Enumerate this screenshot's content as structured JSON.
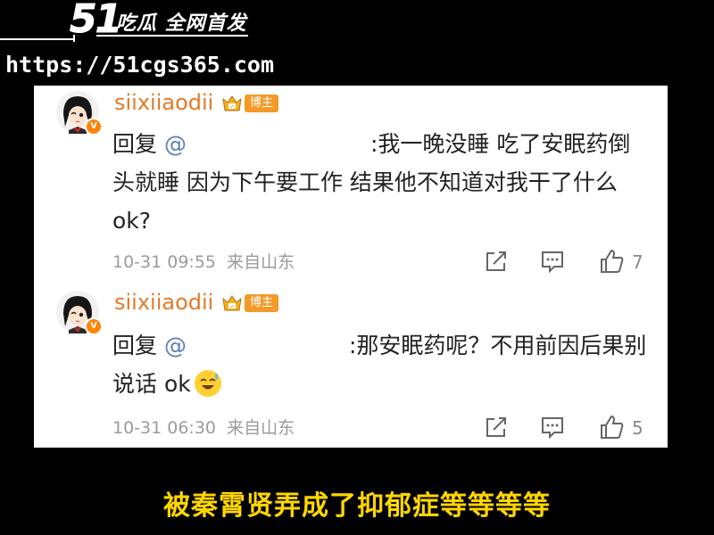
{
  "watermark": {
    "logo": "51",
    "brand": "吃瓜 全网首发",
    "url": "https://51cgs365.com"
  },
  "comments": [
    {
      "username": "siixiiaodii",
      "badge": "博主",
      "reply_prefix": "回复",
      "mention": "@",
      "text": ":我一晚没睡 吃了安眠药倒头就睡 因为下午要工作 结果他不知道对我干了什么 ok?",
      "timestamp": "10-31 09:55",
      "location": "来自山东",
      "likes": "7"
    },
    {
      "username": "siixiiaodii",
      "badge": "博主",
      "reply_prefix": "回复",
      "mention": "@",
      "text": ":那安眠药呢？不用前因后果别说话 ok",
      "timestamp": "10-31 06:30",
      "location": "来自山东",
      "likes": "5"
    }
  ],
  "icons": {
    "verified": "verified-v-icon",
    "crown": "crown-icon",
    "share": "share-icon",
    "comment": "comment-icon",
    "like": "thumbs-up-icon",
    "emoji": "sweat-smile-emoji"
  },
  "colors": {
    "username": "#e47a2a",
    "badge": "#f39a28",
    "mention": "#5b7fb6",
    "subtitle": "#ffd600"
  },
  "subtitle": "被秦霄贤弄成了抑郁症等等等等"
}
